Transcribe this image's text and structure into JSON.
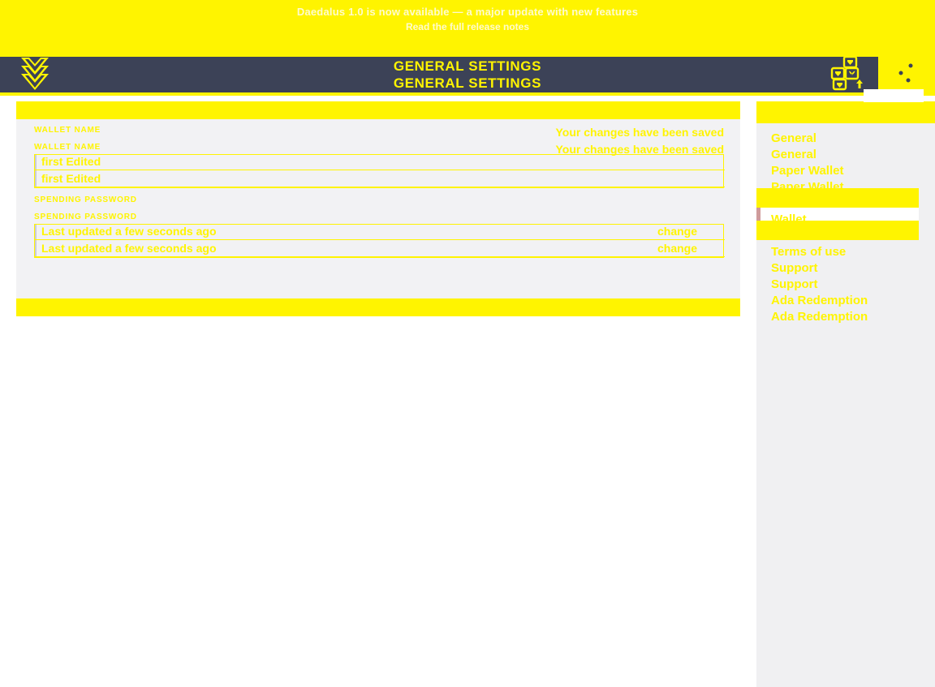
{
  "news_banner": {
    "line1": "Daedalus 1.0 is now available — a major update with new features",
    "line2": "Read the full release notes"
  },
  "topbar": {
    "title": "General Settings",
    "title_ghost": "General Settings",
    "logo_icon": "daedalus-logo-icon",
    "wallets_icon": "wallets-grid-icon",
    "settings_icon": "settings-sliders-icon"
  },
  "settings": {
    "wallet_name": {
      "label": "Wallet name",
      "label_ghost": "Wallet name",
      "value": "first Edited",
      "value_ghost": "first Edited",
      "saved_message": "Your changes have been saved",
      "saved_message_ghost": "Your changes have been saved"
    },
    "spending_password": {
      "label": "Spending password",
      "label_ghost": "Spending password",
      "value": "Last updated a few seconds ago",
      "value_ghost": "Last updated a few seconds ago",
      "change_label": "change",
      "change_label_ghost": "change"
    }
  },
  "sidebar": {
    "items": [
      {
        "label": "General",
        "active": false
      },
      {
        "label": "General",
        "active": false
      },
      {
        "label": "Paper Wallet",
        "active": false
      },
      {
        "label": "Paper Wallet",
        "active": false
      },
      {
        "label": "Wallet",
        "active": true
      },
      {
        "label": "Wallet",
        "active": true
      },
      {
        "label": "Terms of use",
        "active": false
      },
      {
        "label": "Terms of use",
        "active": false
      },
      {
        "label": "Support",
        "active": false
      },
      {
        "label": "Support",
        "active": false
      },
      {
        "label": "Ada Redemption",
        "active": false
      },
      {
        "label": "Ada Redemption",
        "active": false
      }
    ]
  },
  "colors": {
    "accent_yellow": "#fff400",
    "header_navy": "#3c4257",
    "panel_gray": "#f2f2f4",
    "sidebar_gray": "#f0f0f2",
    "active_accent": "#cf9b9b"
  }
}
